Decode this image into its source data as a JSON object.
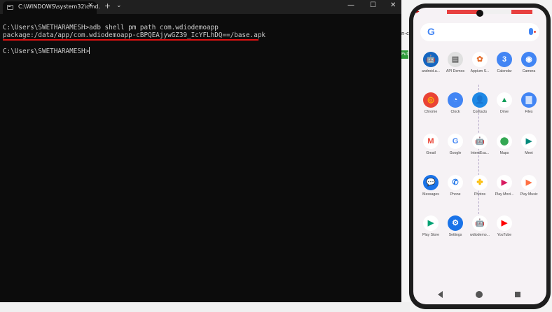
{
  "terminal": {
    "tab_title": "C:\\WINDOWS\\system32\\cmd.",
    "tab_close": "×",
    "new_tab": "+",
    "dropdown": "⌄",
    "minimize": "—",
    "maximize": "☐",
    "close": "✕",
    "lines": [
      "C:\\Users\\SWETHARAMESH>adb shell pm path com.wdiodemoapp",
      "package:/data/app/com.wdiodemoapp-cBPQEAjywGZ39_IcYFLhDQ==/base.apk",
      "",
      "C:\\Users\\SWETHARAMESH>"
    ]
  },
  "strip": {
    "text_a": "n-c",
    "text_b": "Put"
  },
  "phone": {
    "status_left": "▶",
    "search_logo": "G",
    "apps": [
      {
        "label": "android.a...",
        "icon": "android-icon",
        "glyph": "🤖",
        "bg": "#1565c0",
        "fg": "#fff"
      },
      {
        "label": "API Demos",
        "icon": "folder-icon",
        "glyph": "▤",
        "bg": "#e0e0e0",
        "fg": "#666"
      },
      {
        "label": "Appium S...",
        "icon": "appium-icon",
        "glyph": "✿",
        "bg": "#ffffff",
        "fg": "#e56b2a"
      },
      {
        "label": "Calendar",
        "icon": "calendar-icon",
        "glyph": "3",
        "bg": "#4285f4",
        "fg": "#fff"
      },
      {
        "label": "Camera",
        "icon": "camera-icon",
        "glyph": "◉",
        "bg": "#4285f4",
        "fg": "#fff"
      },
      {
        "label": "Chrome",
        "icon": "chrome-icon",
        "glyph": "◎",
        "bg": "#ea4335",
        "fg": "#fbbc05"
      },
      {
        "label": "Clock",
        "icon": "clock-icon",
        "glyph": "◔",
        "bg": "#4285f4",
        "fg": "#fff"
      },
      {
        "label": "Contacts",
        "icon": "contacts-icon",
        "glyph": "👤",
        "bg": "#1e88e5",
        "fg": "#fff"
      },
      {
        "label": "Drive",
        "icon": "drive-icon",
        "glyph": "▲",
        "bg": "#ffffff",
        "fg": "#0f9d58"
      },
      {
        "label": "Files",
        "icon": "files-icon",
        "glyph": "▇",
        "bg": "#4285f4",
        "fg": "#cfe0fb"
      },
      {
        "label": "Gmail",
        "icon": "gmail-icon",
        "glyph": "M",
        "bg": "#ffffff",
        "fg": "#ea4335"
      },
      {
        "label": "Google",
        "icon": "google-icon",
        "glyph": "G",
        "bg": "#ffffff",
        "fg": "#4285f4"
      },
      {
        "label": "IntentExa...",
        "icon": "intent-example-icon",
        "glyph": "🤖",
        "bg": "#ffffff",
        "fg": "#7cb342"
      },
      {
        "label": "Maps",
        "icon": "maps-icon",
        "glyph": "⬤",
        "bg": "#ffffff",
        "fg": "#34a853"
      },
      {
        "label": "Meet",
        "icon": "meet-icon",
        "glyph": "▶",
        "bg": "#ffffff",
        "fg": "#00897b"
      },
      {
        "label": "Messages",
        "icon": "messages-icon",
        "glyph": "💬",
        "bg": "#1a73e8",
        "fg": "#fff"
      },
      {
        "label": "Phone",
        "icon": "phone-icon",
        "glyph": "✆",
        "bg": "#ffffff",
        "fg": "#1a73e8"
      },
      {
        "label": "Photos",
        "icon": "photos-icon",
        "glyph": "✤",
        "bg": "#ffffff",
        "fg": "#fbbc05"
      },
      {
        "label": "Play Movi...",
        "icon": "play-movies-icon",
        "glyph": "▶",
        "bg": "#ffffff",
        "fg": "#d81b60"
      },
      {
        "label": "Play Music",
        "icon": "play-music-icon",
        "glyph": "▶",
        "bg": "#ffffff",
        "fg": "#ff7043"
      },
      {
        "label": "Play Store",
        "icon": "play-store-icon",
        "glyph": "▶",
        "bg": "#ffffff",
        "fg": "#00a173"
      },
      {
        "label": "Settings",
        "icon": "settings-icon",
        "glyph": "⚙",
        "bg": "#1a73e8",
        "fg": "#fff"
      },
      {
        "label": "wdiodemo...",
        "icon": "wdiodemo-icon",
        "glyph": "🤖",
        "bg": "#ffffff",
        "fg": "#e57a3b"
      },
      {
        "label": "YouTube",
        "icon": "youtube-icon",
        "glyph": "▶",
        "bg": "#ffffff",
        "fg": "#ff0000"
      }
    ]
  }
}
